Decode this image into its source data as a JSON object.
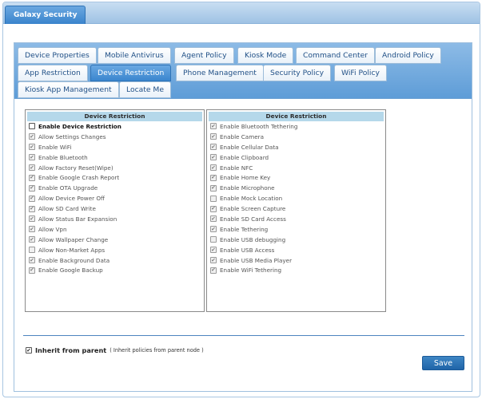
{
  "window": {
    "title": "Galaxy Security"
  },
  "tabs": {
    "row1": [
      "Device Properties",
      "Mobile Antivirus",
      "Agent Policy",
      "Kiosk Mode",
      "Command Center",
      "Android Policy"
    ],
    "row2": [
      "App Restriction",
      "Device Restriction",
      "Phone Management",
      "Security Policy",
      "WiFi Policy"
    ],
    "row3": [
      "Kiosk App Management",
      "Locate Me"
    ],
    "active": "Device Restriction"
  },
  "left_box": {
    "header": "Device Restriction",
    "items": [
      {
        "label": "Enable Device Restriction",
        "checked": false,
        "enabled": true,
        "bold": true
      },
      {
        "label": "Allow Settings Changes",
        "checked": true,
        "enabled": false
      },
      {
        "label": "Enable WiFi",
        "checked": true,
        "enabled": false
      },
      {
        "label": "Enable Bluetooth",
        "checked": true,
        "enabled": false
      },
      {
        "label": "Allow Factory Reset(Wipe)",
        "checked": true,
        "enabled": false
      },
      {
        "label": "Enable Google Crash Report",
        "checked": true,
        "enabled": false
      },
      {
        "label": "Enable OTA Upgrade",
        "checked": true,
        "enabled": false
      },
      {
        "label": "Allow Device Power Off",
        "checked": true,
        "enabled": false
      },
      {
        "label": "Allow SD Card Write",
        "checked": true,
        "enabled": false
      },
      {
        "label": "Allow Status Bar Expansion",
        "checked": true,
        "enabled": false
      },
      {
        "label": "Allow Vpn",
        "checked": true,
        "enabled": false
      },
      {
        "label": "Allow Wallpaper Change",
        "checked": true,
        "enabled": false
      },
      {
        "label": "Allow Non-Market Apps",
        "checked": false,
        "enabled": false
      },
      {
        "label": "Enable Background Data",
        "checked": true,
        "enabled": false
      },
      {
        "label": "Enable Google Backup",
        "checked": true,
        "enabled": false
      }
    ]
  },
  "right_box": {
    "header": "Device Restriction",
    "items": [
      {
        "label": "Enable Bluetooth Tethering",
        "checked": true,
        "enabled": false
      },
      {
        "label": "Enable Camera",
        "checked": true,
        "enabled": false
      },
      {
        "label": "Enable Cellular Data",
        "checked": true,
        "enabled": false
      },
      {
        "label": "Enable Clipboard",
        "checked": true,
        "enabled": false
      },
      {
        "label": "Enable NFC",
        "checked": true,
        "enabled": false
      },
      {
        "label": "Enable Home Key",
        "checked": true,
        "enabled": false
      },
      {
        "label": "Enable Microphone",
        "checked": true,
        "enabled": false
      },
      {
        "label": "Enable Mock Location",
        "checked": false,
        "enabled": false
      },
      {
        "label": "Enable Screen Capture",
        "checked": true,
        "enabled": false
      },
      {
        "label": "Enable SD Card Access",
        "checked": true,
        "enabled": false
      },
      {
        "label": "Enable Tethering",
        "checked": true,
        "enabled": false
      },
      {
        "label": "Enable USB debugging",
        "checked": false,
        "enabled": false
      },
      {
        "label": "Enable USB Access",
        "checked": true,
        "enabled": false
      },
      {
        "label": "Enable USB Media Player",
        "checked": true,
        "enabled": false
      },
      {
        "label": "Enable WiFi Tethering",
        "checked": true,
        "enabled": false
      }
    ]
  },
  "inherit": {
    "label": "Inherit from parent",
    "note": "( Inherit policies from parent node )",
    "checked": true
  },
  "save_label": "Save"
}
